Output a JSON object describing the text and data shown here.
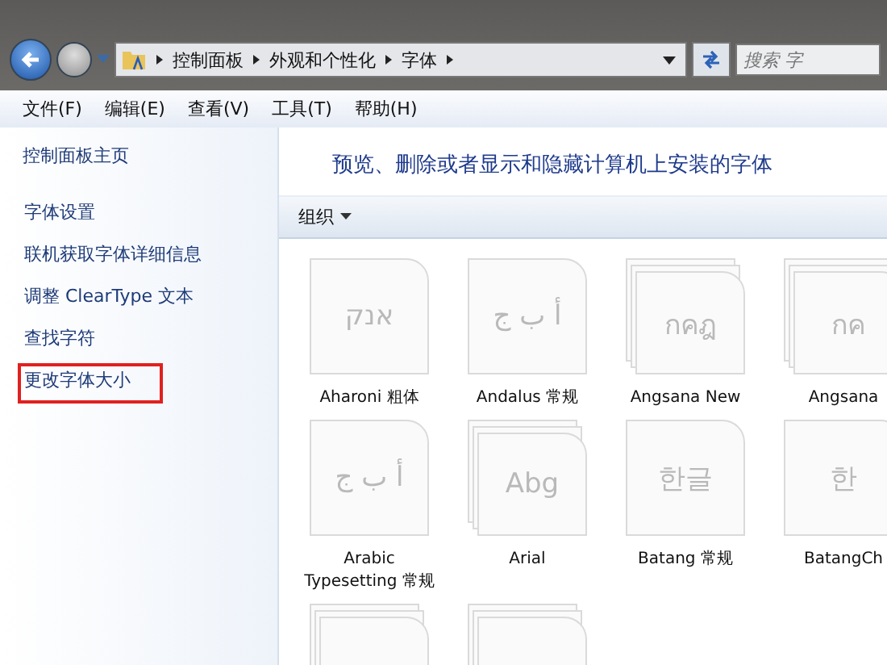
{
  "address_bar": {
    "breadcrumbs": [
      "控制面板",
      "外观和个性化",
      "字体"
    ],
    "search": {
      "placeholder": "搜索 字"
    }
  },
  "menu": [
    "文件(F)",
    "编辑(E)",
    "查看(V)",
    "工具(T)",
    "帮助(H)"
  ],
  "sidebar": {
    "home": "控制面板主页",
    "links": [
      {
        "label": "字体设置",
        "highlighted": false
      },
      {
        "label": "联机获取字体详细信息",
        "highlighted": false
      },
      {
        "label": "调整 ClearType 文本",
        "highlighted": false
      },
      {
        "label": "查找字符",
        "highlighted": false
      },
      {
        "label": "更改字体大小",
        "highlighted": true
      }
    ]
  },
  "header": "预览、删除或者显示和隐藏计算机上安装的字体",
  "toolbar": {
    "organize": "组织"
  },
  "fonts": [
    {
      "kind": "single",
      "preview": "אנק",
      "name": "Aharoni 粗体"
    },
    {
      "kind": "single",
      "preview": "أ ب ج",
      "name": "Andalus 常规"
    },
    {
      "kind": "family",
      "preview": "กคฎ",
      "name": "Angsana New"
    },
    {
      "kind": "family",
      "preview": "กค",
      "name": "Angsana"
    },
    {
      "kind": "single",
      "preview": "أ ب ج",
      "name": "Arabic Typesetting 常规"
    },
    {
      "kind": "family",
      "preview": "Abg",
      "name": "Arial"
    },
    {
      "kind": "single",
      "preview": "한글",
      "name": "Batang 常规"
    },
    {
      "kind": "single",
      "preview": "한",
      "name": "BatangCh"
    },
    {
      "kind": "family"
    },
    {
      "kind": "family"
    }
  ]
}
